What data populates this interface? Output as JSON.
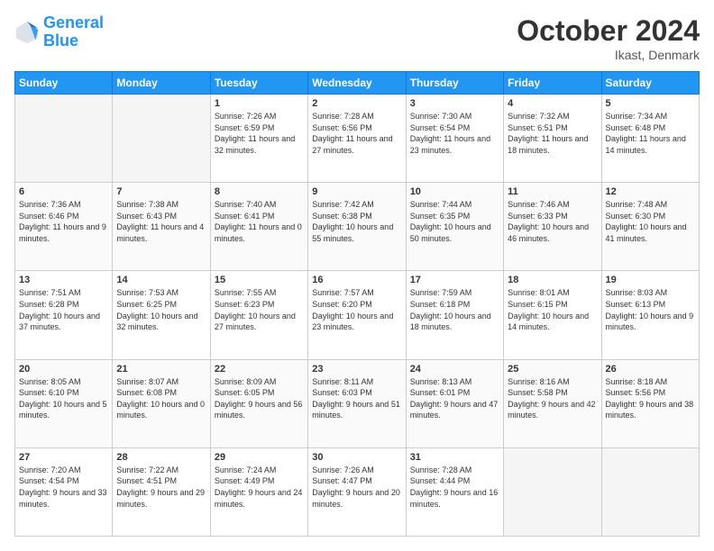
{
  "logo": {
    "line1": "General",
    "line2": "Blue"
  },
  "title": "October 2024",
  "location": "Ikast, Denmark",
  "headers": [
    "Sunday",
    "Monday",
    "Tuesday",
    "Wednesday",
    "Thursday",
    "Friday",
    "Saturday"
  ],
  "weeks": [
    [
      {
        "day": "",
        "sunrise": "",
        "sunset": "",
        "daylight": ""
      },
      {
        "day": "",
        "sunrise": "",
        "sunset": "",
        "daylight": ""
      },
      {
        "day": "1",
        "sunrise": "Sunrise: 7:26 AM",
        "sunset": "Sunset: 6:59 PM",
        "daylight": "Daylight: 11 hours and 32 minutes."
      },
      {
        "day": "2",
        "sunrise": "Sunrise: 7:28 AM",
        "sunset": "Sunset: 6:56 PM",
        "daylight": "Daylight: 11 hours and 27 minutes."
      },
      {
        "day": "3",
        "sunrise": "Sunrise: 7:30 AM",
        "sunset": "Sunset: 6:54 PM",
        "daylight": "Daylight: 11 hours and 23 minutes."
      },
      {
        "day": "4",
        "sunrise": "Sunrise: 7:32 AM",
        "sunset": "Sunset: 6:51 PM",
        "daylight": "Daylight: 11 hours and 18 minutes."
      },
      {
        "day": "5",
        "sunrise": "Sunrise: 7:34 AM",
        "sunset": "Sunset: 6:48 PM",
        "daylight": "Daylight: 11 hours and 14 minutes."
      }
    ],
    [
      {
        "day": "6",
        "sunrise": "Sunrise: 7:36 AM",
        "sunset": "Sunset: 6:46 PM",
        "daylight": "Daylight: 11 hours and 9 minutes."
      },
      {
        "day": "7",
        "sunrise": "Sunrise: 7:38 AM",
        "sunset": "Sunset: 6:43 PM",
        "daylight": "Daylight: 11 hours and 4 minutes."
      },
      {
        "day": "8",
        "sunrise": "Sunrise: 7:40 AM",
        "sunset": "Sunset: 6:41 PM",
        "daylight": "Daylight: 11 hours and 0 minutes."
      },
      {
        "day": "9",
        "sunrise": "Sunrise: 7:42 AM",
        "sunset": "Sunset: 6:38 PM",
        "daylight": "Daylight: 10 hours and 55 minutes."
      },
      {
        "day": "10",
        "sunrise": "Sunrise: 7:44 AM",
        "sunset": "Sunset: 6:35 PM",
        "daylight": "Daylight: 10 hours and 50 minutes."
      },
      {
        "day": "11",
        "sunrise": "Sunrise: 7:46 AM",
        "sunset": "Sunset: 6:33 PM",
        "daylight": "Daylight: 10 hours and 46 minutes."
      },
      {
        "day": "12",
        "sunrise": "Sunrise: 7:48 AM",
        "sunset": "Sunset: 6:30 PM",
        "daylight": "Daylight: 10 hours and 41 minutes."
      }
    ],
    [
      {
        "day": "13",
        "sunrise": "Sunrise: 7:51 AM",
        "sunset": "Sunset: 6:28 PM",
        "daylight": "Daylight: 10 hours and 37 minutes."
      },
      {
        "day": "14",
        "sunrise": "Sunrise: 7:53 AM",
        "sunset": "Sunset: 6:25 PM",
        "daylight": "Daylight: 10 hours and 32 minutes."
      },
      {
        "day": "15",
        "sunrise": "Sunrise: 7:55 AM",
        "sunset": "Sunset: 6:23 PM",
        "daylight": "Daylight: 10 hours and 27 minutes."
      },
      {
        "day": "16",
        "sunrise": "Sunrise: 7:57 AM",
        "sunset": "Sunset: 6:20 PM",
        "daylight": "Daylight: 10 hours and 23 minutes."
      },
      {
        "day": "17",
        "sunrise": "Sunrise: 7:59 AM",
        "sunset": "Sunset: 6:18 PM",
        "daylight": "Daylight: 10 hours and 18 minutes."
      },
      {
        "day": "18",
        "sunrise": "Sunrise: 8:01 AM",
        "sunset": "Sunset: 6:15 PM",
        "daylight": "Daylight: 10 hours and 14 minutes."
      },
      {
        "day": "19",
        "sunrise": "Sunrise: 8:03 AM",
        "sunset": "Sunset: 6:13 PM",
        "daylight": "Daylight: 10 hours and 9 minutes."
      }
    ],
    [
      {
        "day": "20",
        "sunrise": "Sunrise: 8:05 AM",
        "sunset": "Sunset: 6:10 PM",
        "daylight": "Daylight: 10 hours and 5 minutes."
      },
      {
        "day": "21",
        "sunrise": "Sunrise: 8:07 AM",
        "sunset": "Sunset: 6:08 PM",
        "daylight": "Daylight: 10 hours and 0 minutes."
      },
      {
        "day": "22",
        "sunrise": "Sunrise: 8:09 AM",
        "sunset": "Sunset: 6:05 PM",
        "daylight": "Daylight: 9 hours and 56 minutes."
      },
      {
        "day": "23",
        "sunrise": "Sunrise: 8:11 AM",
        "sunset": "Sunset: 6:03 PM",
        "daylight": "Daylight: 9 hours and 51 minutes."
      },
      {
        "day": "24",
        "sunrise": "Sunrise: 8:13 AM",
        "sunset": "Sunset: 6:01 PM",
        "daylight": "Daylight: 9 hours and 47 minutes."
      },
      {
        "day": "25",
        "sunrise": "Sunrise: 8:16 AM",
        "sunset": "Sunset: 5:58 PM",
        "daylight": "Daylight: 9 hours and 42 minutes."
      },
      {
        "day": "26",
        "sunrise": "Sunrise: 8:18 AM",
        "sunset": "Sunset: 5:56 PM",
        "daylight": "Daylight: 9 hours and 38 minutes."
      }
    ],
    [
      {
        "day": "27",
        "sunrise": "Sunrise: 7:20 AM",
        "sunset": "Sunset: 4:54 PM",
        "daylight": "Daylight: 9 hours and 33 minutes."
      },
      {
        "day": "28",
        "sunrise": "Sunrise: 7:22 AM",
        "sunset": "Sunset: 4:51 PM",
        "daylight": "Daylight: 9 hours and 29 minutes."
      },
      {
        "day": "29",
        "sunrise": "Sunrise: 7:24 AM",
        "sunset": "Sunset: 4:49 PM",
        "daylight": "Daylight: 9 hours and 24 minutes."
      },
      {
        "day": "30",
        "sunrise": "Sunrise: 7:26 AM",
        "sunset": "Sunset: 4:47 PM",
        "daylight": "Daylight: 9 hours and 20 minutes."
      },
      {
        "day": "31",
        "sunrise": "Sunrise: 7:28 AM",
        "sunset": "Sunset: 4:44 PM",
        "daylight": "Daylight: 9 hours and 16 minutes."
      },
      {
        "day": "",
        "sunrise": "",
        "sunset": "",
        "daylight": ""
      },
      {
        "day": "",
        "sunrise": "",
        "sunset": "",
        "daylight": ""
      }
    ]
  ]
}
